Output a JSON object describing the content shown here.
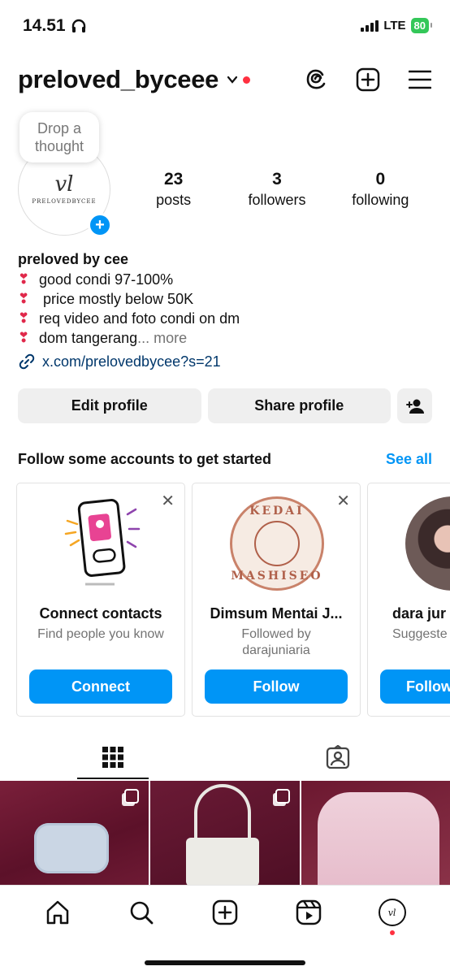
{
  "status_bar": {
    "time": "14.51",
    "network": "LTE",
    "battery": "80"
  },
  "header": {
    "username": "preloved_byceee"
  },
  "profile": {
    "thought_bubble": "Drop a thought",
    "avatar_logo_text": "vl",
    "avatar_logo_name": "PRELOVEDBYCEE",
    "posts": {
      "count": "23",
      "label": "posts"
    },
    "followers": {
      "count": "3",
      "label": "followers"
    },
    "following": {
      "count": "0",
      "label": "following"
    },
    "display_name": "preloved by cee",
    "bio_lines": [
      "good condi 97-100%",
      " price mostly below 50K",
      "req video and foto condi on dm",
      "dom tangerang"
    ],
    "bio_more": "... more",
    "link": "x.com/prelovedbycee?s=21"
  },
  "actions": {
    "edit_profile": "Edit profile",
    "share_profile": "Share profile"
  },
  "suggestions": {
    "title": "Follow some accounts to get started",
    "see_all": "See all",
    "cards": [
      {
        "title": "Connect contacts",
        "subtitle": "Find people you know",
        "button": "Connect"
      },
      {
        "title": "Dimsum Mentai J...",
        "subtitle": "Followed by darajuniaria",
        "subtitle_line1": "Followed by",
        "subtitle_line2": "darajuniaria",
        "button": "Follow",
        "logo_top": "KEDAI",
        "logo_bottom": "MASHISEO"
      },
      {
        "title": "dara jur",
        "subtitle": "Suggeste",
        "button": "Follow"
      }
    ]
  },
  "colors": {
    "accent": "#0095f6",
    "notification": "#ff3040",
    "heart": "#e0284a"
  }
}
